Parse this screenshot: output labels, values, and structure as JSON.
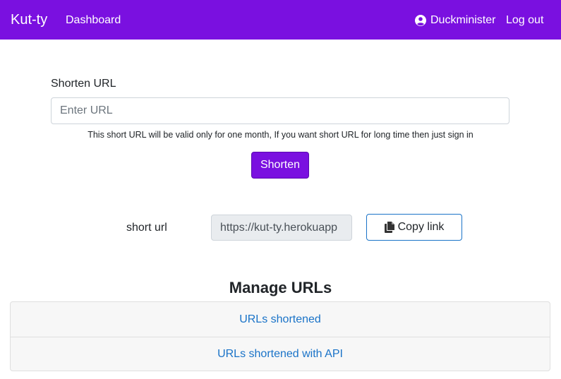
{
  "navbar": {
    "brand": "Kut-ty",
    "dashboard": "Dashboard",
    "username": "Duckminister",
    "logout": "Log out",
    "background": "#7a10e0",
    "user_icon": "user-circle-icon"
  },
  "form": {
    "label": "Shorten URL",
    "placeholder": "Enter URL",
    "hint": "This short URL will be valid only for one month, If you want short URL for long time then just sign in",
    "submit": "Shorten"
  },
  "result": {
    "label": "short url",
    "value": "https://kut-ty.herokuapp",
    "copy_label": "Copy link",
    "copy_icon": "copy-icon"
  },
  "manage": {
    "title": "Manage URLs",
    "items": [
      {
        "label": "URLs shortened"
      },
      {
        "label": "URLs shortened with API"
      }
    ]
  }
}
